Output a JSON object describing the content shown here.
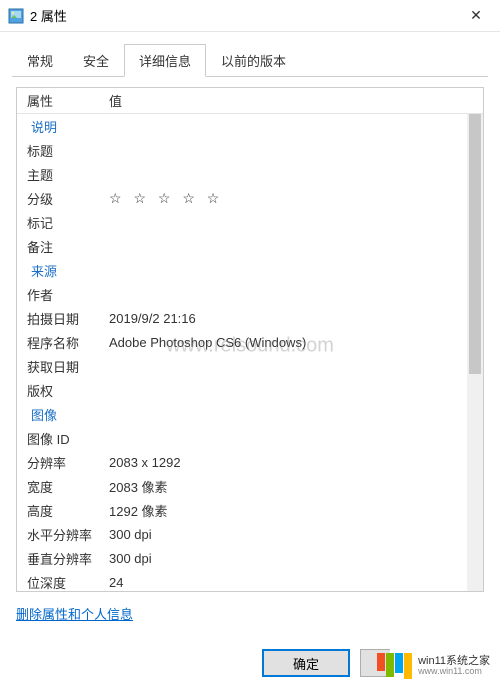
{
  "window": {
    "title": "2 属性"
  },
  "tabs": {
    "general": "常规",
    "security": "安全",
    "details": "详细信息",
    "previous": "以前的版本"
  },
  "headers": {
    "property": "属性",
    "value": "值"
  },
  "sections": {
    "description": "说明",
    "origin": "来源",
    "image": "图像"
  },
  "props": {
    "title": {
      "label": "标题",
      "value": ""
    },
    "subject": {
      "label": "主题",
      "value": ""
    },
    "rating": {
      "label": "分级",
      "value": "☆ ☆ ☆ ☆ ☆"
    },
    "tags": {
      "label": "标记",
      "value": ""
    },
    "comments": {
      "label": "备注",
      "value": ""
    },
    "author": {
      "label": "作者",
      "value": ""
    },
    "date_taken": {
      "label": "拍摄日期",
      "value": "2019/9/2 21:16"
    },
    "program": {
      "label": "程序名称",
      "value": "Adobe Photoshop CS6 (Windows)"
    },
    "date_acquired": {
      "label": "获取日期",
      "value": ""
    },
    "copyright": {
      "label": "版权",
      "value": ""
    },
    "image_id": {
      "label": "图像 ID",
      "value": ""
    },
    "dimensions": {
      "label": "分辨率",
      "value": "2083 x 1292"
    },
    "width": {
      "label": "宽度",
      "value": "2083 像素"
    },
    "height": {
      "label": "高度",
      "value": "1292 像素"
    },
    "hres": {
      "label": "水平分辨率",
      "value": "300 dpi"
    },
    "vres": {
      "label": "垂直分辨率",
      "value": "300 dpi"
    },
    "bitdepth": {
      "label": "位深度",
      "value": "24"
    }
  },
  "link": "删除属性和个人信息",
  "buttons": {
    "ok": "确定"
  },
  "watermark": "www.relsound.com",
  "brand": {
    "top": "win11系统之家",
    "sub": "www.win11.com"
  },
  "colors": {
    "link": "#0066cc",
    "section": "#1a6fc4",
    "focus": "#0078d7"
  }
}
